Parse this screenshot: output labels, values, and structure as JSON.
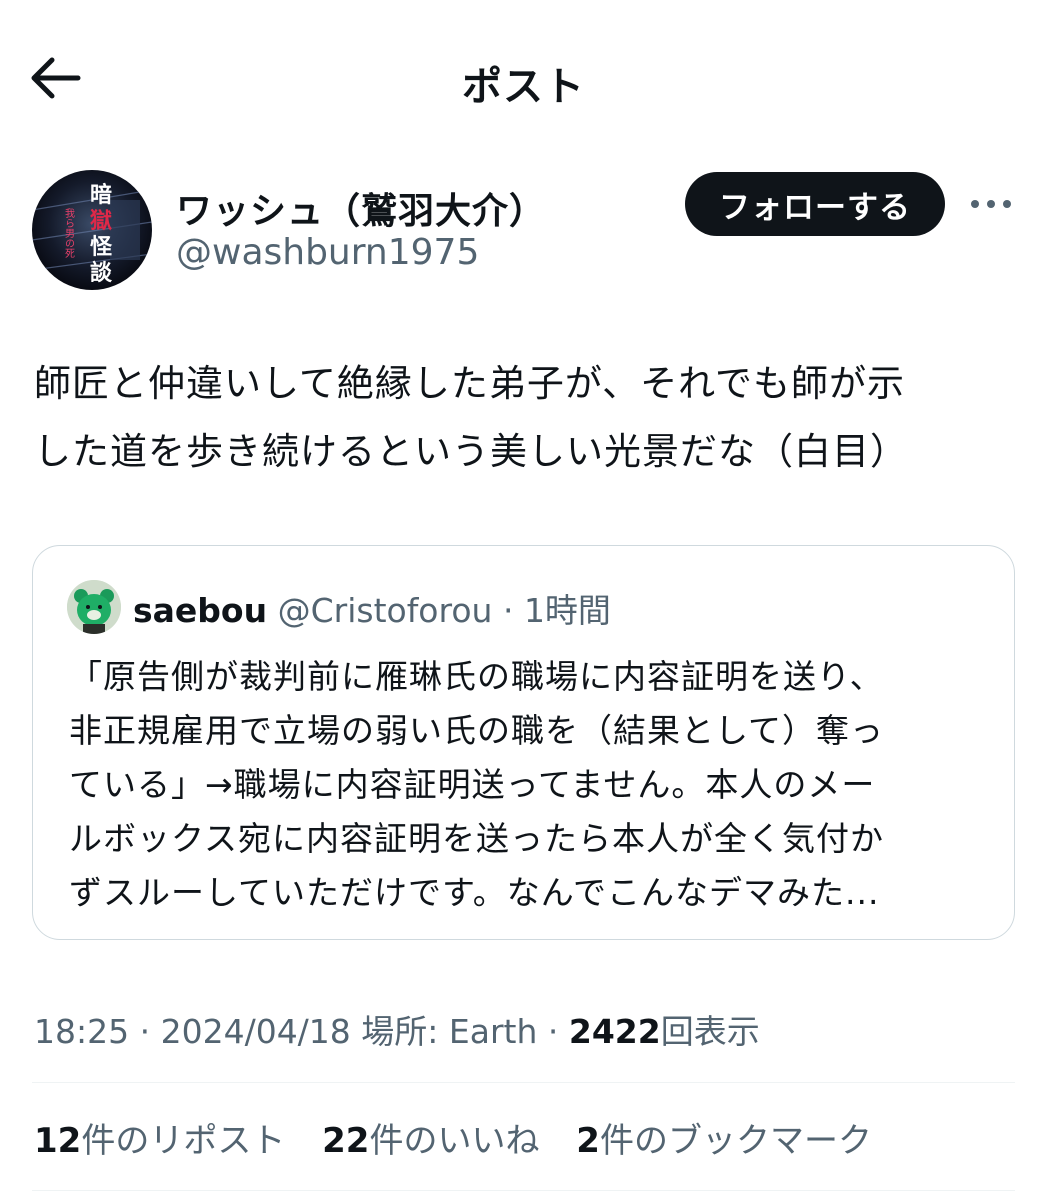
{
  "header": {
    "title": "ポスト",
    "back_icon": "arrow-left-icon"
  },
  "author": {
    "display_name": "ワッシュ（鷲羽大介）",
    "handle": "@washburn1975",
    "avatar_icon": "user-avatar",
    "avatar_text": [
      "暗",
      "獄",
      "怪",
      "談"
    ],
    "avatar_small_text": "我ら男の死"
  },
  "actions": {
    "follow_label": "フォローする",
    "more_icon": "more-horizontal-icon"
  },
  "tweet": {
    "text_line1": "師匠と仲違いして絶縁した弟子が、それでも師が示",
    "text_line2": "した道を歩き続けるという美しい光景だな（白目）"
  },
  "quote": {
    "name": "saebou",
    "handle": "@Cristoforou",
    "separator": " · ",
    "time": "1時間",
    "avatar_icon": "green-bear-avatar",
    "lines": [
      "「原告側が裁判前に雁琳氏の職場に内容証明を送り、",
      "非正規雇用で立場の弱い氏の職を（結果として）奪っ",
      "ている」→職場に内容証明送ってません。本人のメー",
      "ルボックス宛に内容証明を送ったら本人が全く気付か",
      "ずスルーしていただけです。なんでこんなデマみた..."
    ]
  },
  "meta": {
    "time": "18:25",
    "sep1": " · ",
    "date": "2024/04/18",
    "location": " 場所: Earth",
    "sep2": " · ",
    "views": "2422",
    "views_label": "回表示"
  },
  "stats": {
    "reposts_count": "12",
    "reposts_label": "件のリポスト",
    "likes_count": "22",
    "likes_label": "件のいいね",
    "bookmarks_count": "2",
    "bookmarks_label": "件のブックマーク"
  },
  "colors": {
    "text": "#0f1419",
    "secondary": "#536471",
    "border": "#cfd9de",
    "divider": "#eff3f4",
    "button_bg": "#0f1419",
    "button_text": "#ffffff"
  }
}
